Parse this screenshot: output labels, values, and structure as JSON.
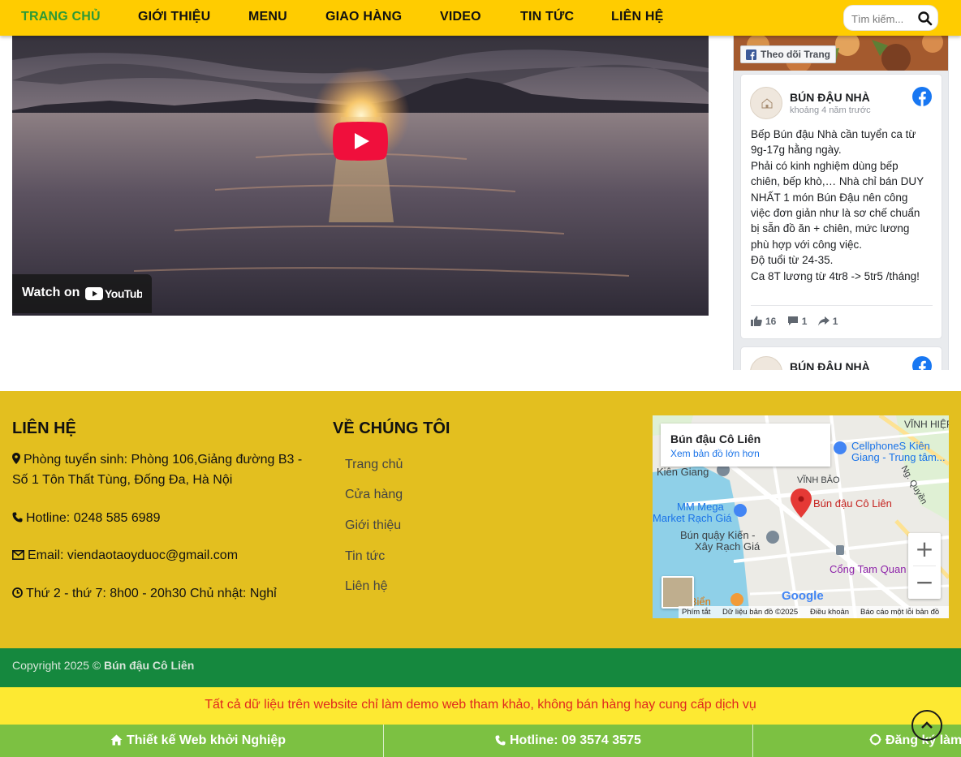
{
  "nav": {
    "items": [
      "TRANG CHỦ",
      "GIỚI THIỆU",
      "MENU",
      "GIAO HÀNG",
      "VIDEO",
      "TIN TỨC",
      "LIÊN HỆ"
    ],
    "search_placeholder": "Tìm kiếm...",
    "active_color": "#2e9a36"
  },
  "video": {
    "watch_label": "Watch on",
    "brand": "YouTube"
  },
  "facebook": {
    "follow_label": "Theo dõi Trang",
    "posts": [
      {
        "page_name": "BÚN ĐẬU NHÀ",
        "time": "khoảng 4 năm trước",
        "text_lines": [
          "Bếp Bún đậu Nhà cần tuyển ca từ",
          "9g-17g hằng ngày.",
          "Phải có kinh nghiệm dùng bếp",
          "chiên, bếp khò,… Nhà chỉ bán DUY",
          "NHẤT 1 món Bún Đậu nên công",
          "việc đơn giản như là sơ chế chuẩn",
          "bị sẵn đồ ăn + chiên, mức lương",
          "phù hợp với công việc.",
          "Độ tuổi từ 24-35.",
          "Ca 8T lương từ 4tr8 -> 5tr5 /tháng!"
        ],
        "likes": "16",
        "comments": "1",
        "shares": "1"
      },
      {
        "page_name": "BÚN ĐẬU NHÀ"
      }
    ]
  },
  "footer": {
    "contact_title": "LIÊN HỆ",
    "address": "Phòng tuyển sinh: Phòng 106,Giảng đường B3 - Số 1 Tôn Thất Tùng, Đống Đa, Hà Nội",
    "hotline": "Hotline: 0248 585 6989",
    "email": "Email: viendaotaoyduoc@gmail.com",
    "hours": "Thứ 2 - thứ 7: 8h00 - 20h30 Chủ nhật: Nghỉ",
    "about_title": "VỀ CHÚNG TÔI",
    "about_links": [
      "Trang chủ",
      "Cửa hàng",
      "Giới thiệu",
      "Tin tức",
      "Liên hệ"
    ]
  },
  "map": {
    "place_name": "Bún đậu Cô Liên",
    "view_larger": "Xem bản đồ lớn hơn",
    "labels": {
      "kien_giang": "Kiên Giang",
      "vinh_bao": "VĨNH BẢO",
      "vinh_hiep": "VĨNH HIỆP",
      "cellphones": "CellphoneS Kiên",
      "cellphones2": "Giang - Trung tâm...",
      "mm_mega": "MM Mega",
      "mm_mega2": "Market Rạch Giá",
      "bun_quay": "Bún quậy Kiến -",
      "bun_quay2": "Xây Rạch Giá",
      "cong_tam_quan": "Cổng Tam Quan",
      "pin_label": "Bún đậu Cô Liên",
      "bien": "ó Biển",
      "ng_quyen": "Ng. Quyền"
    },
    "google": "Google",
    "footer": {
      "shortcuts": "Phím tắt",
      "data": "Dữ liệu bản đồ ©2025",
      "terms": "Điều khoản",
      "report": "Báo cáo một lỗi bản đồ"
    },
    "zoom_in": "+",
    "zoom_out": "−"
  },
  "copyright": {
    "prefix": "Copyright 2025 ©",
    "brand": "Bún đậu Cô Liên"
  },
  "disclaimer": "Tất cả dữ liệu trên website chỉ làm demo web tham khảo, không bán hàng hay cung cấp dịch vụ",
  "bottom_bar": {
    "design": "Thiết kế Web khởi Nghiệp",
    "hotline": "Hotline: 09 3574 3575",
    "register": "Đăng ký làm"
  }
}
